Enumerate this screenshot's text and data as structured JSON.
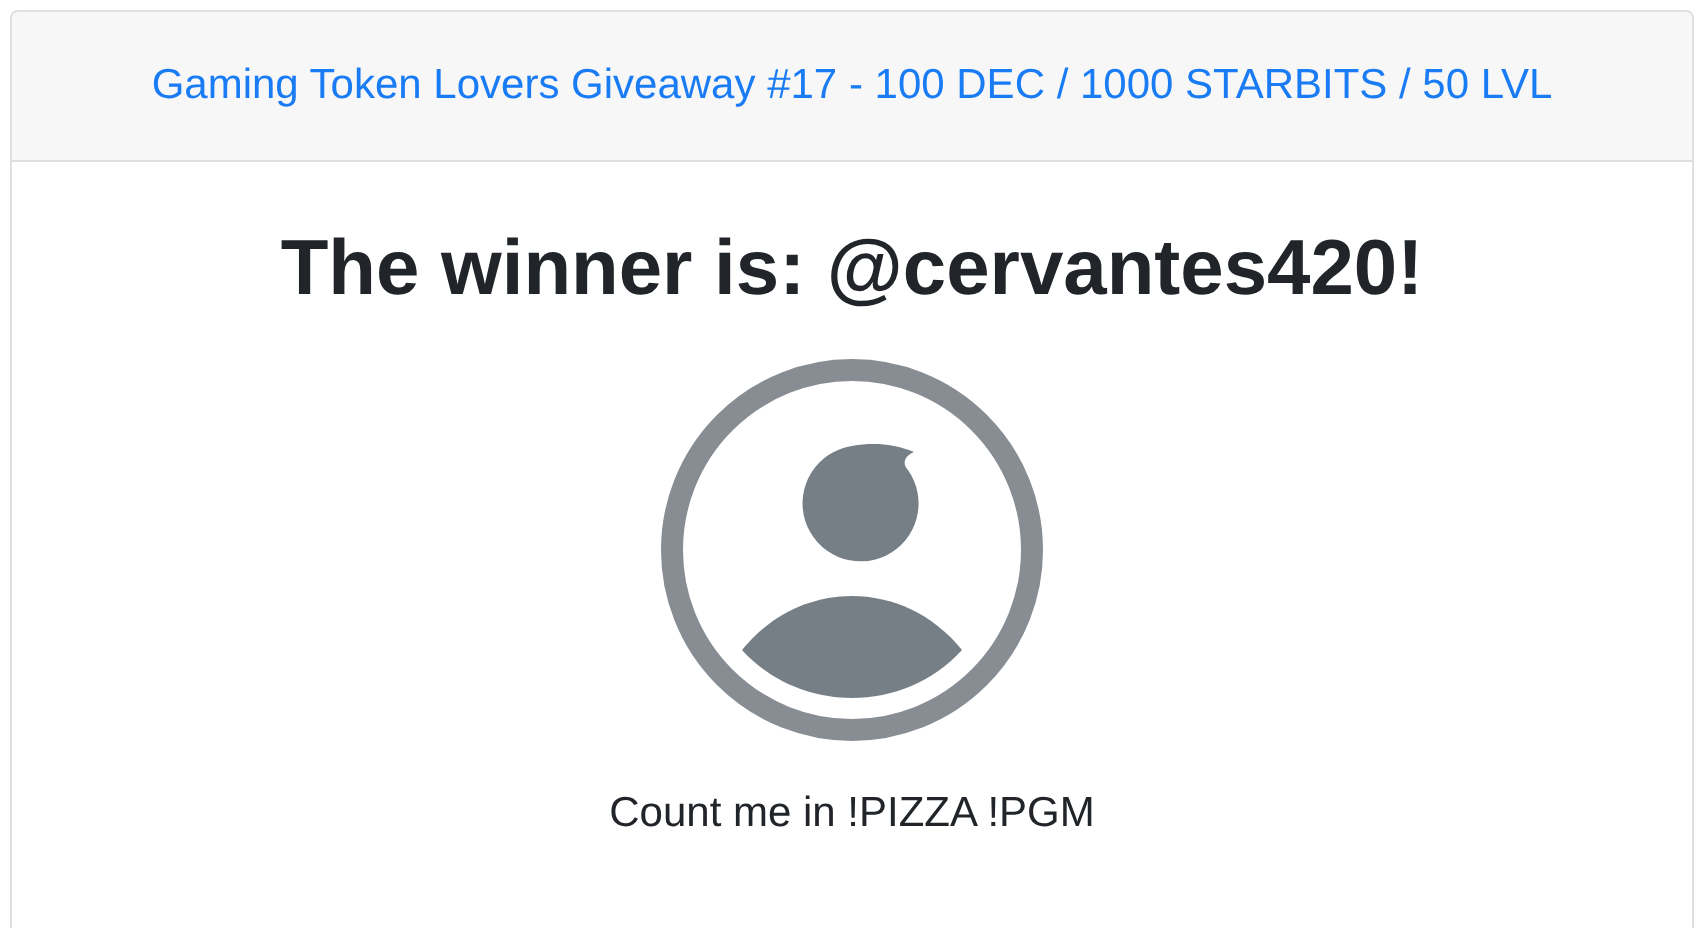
{
  "header": {
    "link": "Gaming Token Lovers Giveaway #17 - 100 DEC / 1000 STARBITS / 50 LVL"
  },
  "winner": {
    "title": "The winner is: @cervantes420!",
    "comment": "Count me in !PIZZA !PGM"
  }
}
